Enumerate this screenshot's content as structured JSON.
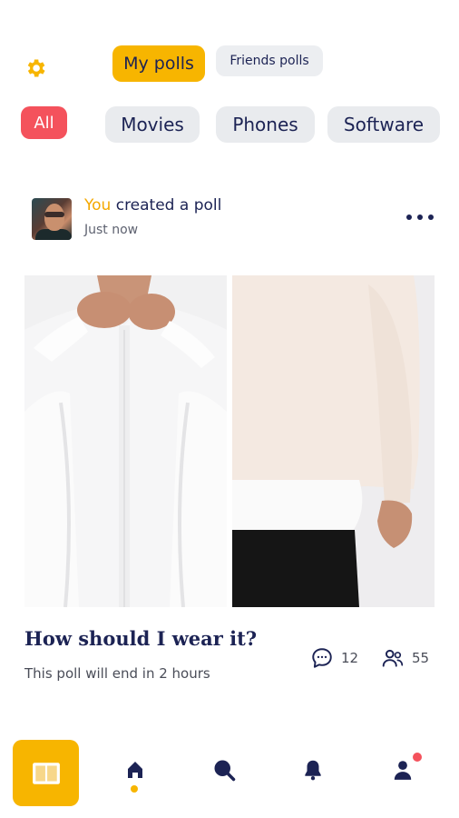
{
  "colors": {
    "accent": "#f7b500",
    "all_chip": "#f4525c",
    "text_primary": "#1c2354",
    "text_secondary": "#4a4d58",
    "chip_bg": "#e9ebee"
  },
  "header": {
    "settings_icon": "gear-icon",
    "tabs": [
      {
        "label": "My polls",
        "active": true
      },
      {
        "label": "Friends polls",
        "active": false
      }
    ]
  },
  "categories": [
    {
      "label": "All",
      "active": true
    },
    {
      "label": "Movies",
      "active": false
    },
    {
      "label": "Phones",
      "active": false
    },
    {
      "label": "Software",
      "active": false
    }
  ],
  "post": {
    "author": "You",
    "action": " created a poll",
    "time": "Just now",
    "more_icon": "more-horizontal-icon",
    "options": [
      {
        "image": "white-shirt-buttoned-photo"
      },
      {
        "image": "cream-sweater-over-shirt-photo"
      }
    ],
    "question": "How should I wear it?",
    "status": "This poll will end in 2 hours",
    "comments": "12",
    "voters": "55"
  },
  "bottom_nav": {
    "items": [
      {
        "icon": "book-open-icon",
        "active_tile": true
      },
      {
        "icon": "home-icon",
        "active": true
      },
      {
        "icon": "search-icon"
      },
      {
        "icon": "bell-icon"
      },
      {
        "icon": "profile-icon",
        "has_notification": true
      }
    ]
  }
}
